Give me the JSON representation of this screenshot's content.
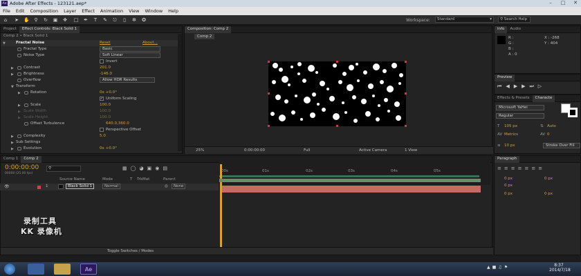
{
  "window": {
    "title": "Adobe After Effects - 123121.aep*",
    "app_icon_label": "Ae"
  },
  "menu": [
    "File",
    "Edit",
    "Composition",
    "Layer",
    "Effect",
    "Animation",
    "View",
    "Window",
    "Help"
  ],
  "toolbar": {
    "workspace_label": "Workspace:",
    "workspace_value": "Standard",
    "search_placeholder": "Search Help"
  },
  "project_panel": {
    "tabs": [
      "Project",
      "Effect Controls: Black Solid 1"
    ],
    "breadcrumb": "Comp 2 • Black Solid 1",
    "effect": {
      "name": "Fractal Noise",
      "reset": "Reset",
      "about": "About..."
    },
    "rows": [
      {
        "name": "Fractal Type",
        "dropdown": "Basic"
      },
      {
        "name": "Noise Type",
        "dropdown": "Soft Linear"
      },
      {
        "name": "",
        "checkbox": "Invert"
      },
      {
        "name": "Contrast",
        "value": "201.0"
      },
      {
        "name": "Brightness",
        "value": "-146.0"
      },
      {
        "name": "Overflow",
        "dropdown": "Allow HDR Results"
      },
      {
        "name": "Transform"
      },
      {
        "name": "Rotation",
        "value": "0x +0.0°"
      },
      {
        "name": "",
        "checkbox": "Uniform Scaling"
      },
      {
        "name": "Scale",
        "value": "100.0"
      },
      {
        "name": "Scale Width",
        "value": "100.0"
      },
      {
        "name": "Scale Height",
        "value": "100.0"
      },
      {
        "name": "Offset Turbulence",
        "value": "640.0,360.0"
      },
      {
        "name": "",
        "checkbox": "Perspective Offset"
      },
      {
        "name": "Complexity",
        "value": "5.0"
      },
      {
        "name": "Sub Settings"
      },
      {
        "name": "Evolution",
        "value": "0x +0.0°"
      }
    ]
  },
  "composition": {
    "tab": "Composition: Comp 2",
    "sub_tab": "Comp 2",
    "footer": {
      "zoom": "25%",
      "timecode": "0:00:00:00",
      "quality": "Full",
      "camera": "Active Camera",
      "views": "1 View"
    }
  },
  "info_panel": {
    "tabs": [
      "Info",
      "Audio"
    ],
    "r": "R :",
    "g": "G :",
    "b": "B :",
    "a": "A : 0",
    "x": "X : -268",
    "y": "Y : 404"
  },
  "preview_panel": {
    "title": "Preview"
  },
  "effects_panel": {
    "tabs": [
      "Effects & Presets",
      "Characte"
    ]
  },
  "character_panel": {
    "font": "Microsoft YaHei",
    "style": "Regular",
    "size": "105 px",
    "leading": "Auto",
    "kerning": "Metrics",
    "tracking": "0",
    "stroke_width": "10 px",
    "stroke_type": "Stroke Over Fill"
  },
  "paragraph_panel": {
    "title": "Paragraph",
    "indent_vals": [
      "0 px",
      "0 px",
      "0 px",
      "0 px",
      "0 px"
    ]
  },
  "timeline": {
    "tabs": [
      "Comp 1",
      "Comp 2"
    ],
    "timecode": "0:00:00:00",
    "fps": "00000 (25.00 fps)",
    "columns": [
      "Source Name",
      "Mode",
      "T",
      "TrkMat",
      "Parent"
    ],
    "ruler": [
      "00s",
      "01s",
      "02s",
      "03s",
      "04s",
      "05s"
    ],
    "layer": {
      "index": "1",
      "name": "Black Solid 1",
      "mode": "Normal",
      "parent": "None"
    },
    "footer": "Toggle Switches / Modes"
  },
  "watermark": {
    "line1": "录制工具",
    "line2": "KK 录像机"
  },
  "taskbar": {
    "time": "8:37",
    "date": "2014/7/18",
    "ae_label": "Ae"
  }
}
